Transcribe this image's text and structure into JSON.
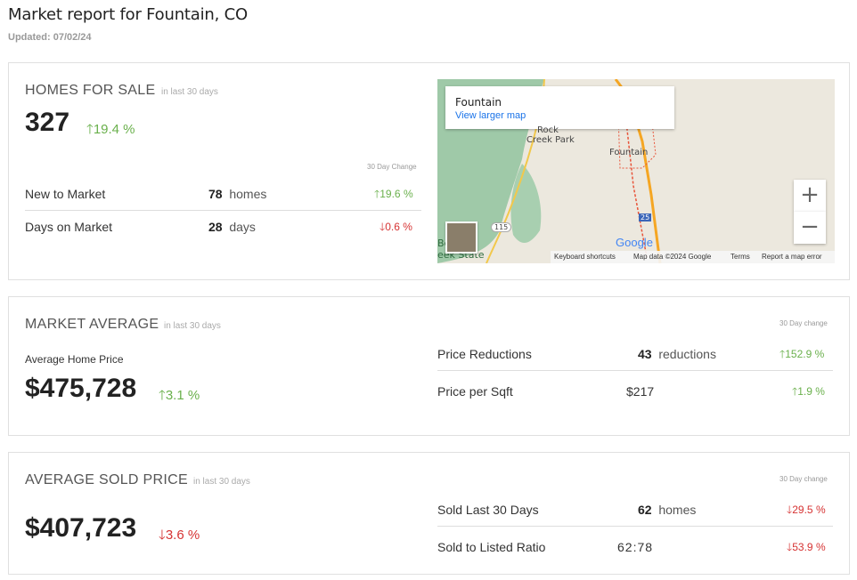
{
  "page": {
    "title": "Market report for Fountain, CO",
    "updated": "Updated: 07/02/24"
  },
  "homes_for_sale": {
    "title": "HOMES FOR SALE",
    "period": "in last 30 days",
    "value": "327",
    "change": "19.4 %",
    "change_direction": "up",
    "change_header": "30 Day Change",
    "rows": [
      {
        "label": "New to Market",
        "value": "78",
        "unit": "homes",
        "change": "19.6 %",
        "direction": "up"
      },
      {
        "label": "Days on Market",
        "value": "28",
        "unit": "days",
        "change": "0.6 %",
        "direction": "down"
      }
    ]
  },
  "map": {
    "place_name": "Fountain",
    "view_larger": "View larger map",
    "labels": {
      "rock": "Rock",
      "creek_park": "Creek Park",
      "fountain": "Fountain",
      "route_115": "115",
      "route_25": "25",
      "partial_a": "Be",
      "partial_b": "eek State"
    },
    "brand": "Google",
    "zoom_in": "+",
    "zoom_out": "−",
    "footer": {
      "shortcuts": "Keyboard shortcuts",
      "mapdata": "Map data ©2024 Google",
      "terms": "Terms",
      "report": "Report a map error"
    }
  },
  "market_average": {
    "title": "MARKET AVERAGE",
    "period": "in last 30 days",
    "change_header": "30 Day change",
    "sub_label": "Average Home Price",
    "value": "$475,728",
    "change": "3.1 %",
    "change_direction": "up",
    "rows": [
      {
        "label": "Price Reductions",
        "value": "43",
        "unit": "reductions",
        "change": "152.9 %",
        "direction": "up"
      },
      {
        "label": "Price per Sqft",
        "value": "$217",
        "unit": "",
        "change": "1.9 %",
        "direction": "up"
      }
    ]
  },
  "average_sold": {
    "title": "AVERAGE SOLD PRICE",
    "period": "in last 30 days",
    "change_header": "30 Day change",
    "value": "$407,723",
    "change": "3.6 %",
    "change_direction": "down",
    "rows": [
      {
        "label": "Sold Last 30 Days",
        "value": "62",
        "unit": "homes",
        "change": "29.5 %",
        "direction": "down"
      },
      {
        "label": "Sold to Listed Ratio",
        "value": "62:78",
        "unit": "",
        "change": "53.9 %",
        "direction": "down"
      }
    ]
  },
  "colors": {
    "up": "#6ab04c",
    "down": "#d63333",
    "link": "#1a73e8"
  }
}
